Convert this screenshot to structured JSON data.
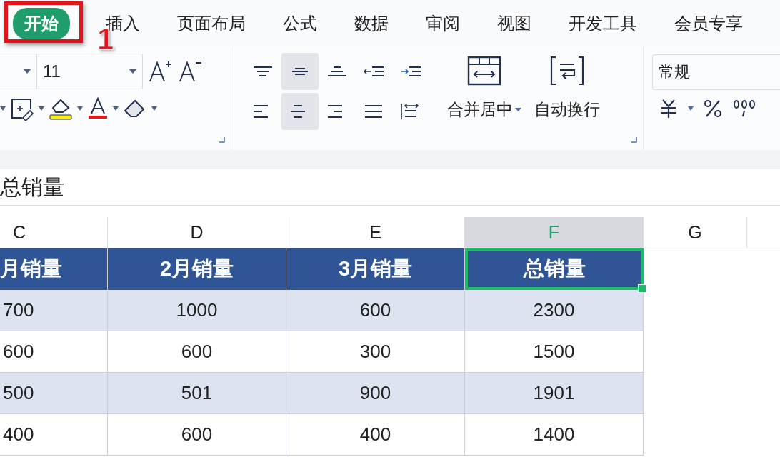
{
  "tabs": [
    {
      "label": "开始",
      "selected": true
    },
    {
      "label": "插入",
      "selected": false
    },
    {
      "label": "页面布局",
      "selected": false
    },
    {
      "label": "公式",
      "selected": false
    },
    {
      "label": "数据",
      "selected": false
    },
    {
      "label": "审阅",
      "selected": false
    },
    {
      "label": "视图",
      "selected": false
    },
    {
      "label": "开发工具",
      "selected": false
    },
    {
      "label": "会员专享",
      "selected": false
    }
  ],
  "callout": {
    "label": "1"
  },
  "font_size": "11",
  "align_buttons": [
    {
      "kind": "top",
      "selected": false
    },
    {
      "kind": "middle",
      "selected": true
    },
    {
      "kind": "bottom",
      "selected": false
    },
    {
      "kind": "outdent",
      "selected": false
    },
    {
      "kind": "indent",
      "selected": false
    },
    {
      "kind": "left",
      "selected": false
    },
    {
      "kind": "center",
      "selected": true
    },
    {
      "kind": "right",
      "selected": false
    },
    {
      "kind": "justify",
      "selected": false
    },
    {
      "kind": "distribute",
      "selected": false
    }
  ],
  "merge_button": "合并居中",
  "wrap_button": "自动换行",
  "number_format": "常规",
  "formula_bar": {
    "value": "总销量"
  },
  "columns": [
    {
      "label": "C",
      "selected": false
    },
    {
      "label": "D",
      "selected": false
    },
    {
      "label": "E",
      "selected": false
    },
    {
      "label": "F",
      "selected": true
    },
    {
      "label": "G",
      "selected": false
    }
  ],
  "header_row": [
    {
      "text": "月销量",
      "selected": false
    },
    {
      "text": "2月销量",
      "selected": false
    },
    {
      "text": "3月销量",
      "selected": false
    },
    {
      "text": "总销量",
      "selected": true
    }
  ],
  "rows": [
    [
      "700",
      "1000",
      "600",
      "2300"
    ],
    [
      "600",
      "600",
      "300",
      "1500"
    ],
    [
      "500",
      "501",
      "900",
      "1901"
    ],
    [
      "400",
      "600",
      "400",
      "1400"
    ]
  ]
}
